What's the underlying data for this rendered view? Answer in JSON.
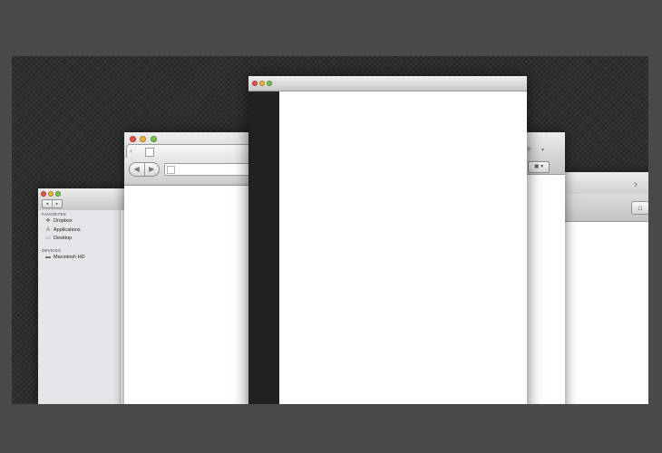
{
  "finder": {
    "nav_back": "◂",
    "nav_forward": "▸",
    "sections": [
      {
        "heading": "FAVORITES",
        "items": [
          {
            "label": "Dropbox",
            "icon": "dropbox-icon"
          },
          {
            "label": "Applications",
            "icon": "applications-icon"
          },
          {
            "label": "Desktop",
            "icon": "desktop-icon"
          }
        ]
      },
      {
        "heading": "DEVICES",
        "items": [
          {
            "label": "Macintosh HD",
            "icon": "hard-drive-icon"
          }
        ]
      }
    ]
  },
  "browser_left": {
    "back": "◀",
    "forward": "▶",
    "tab_nav": "‹"
  },
  "browser_right": {
    "forward_tab": "›",
    "home": "⌂"
  },
  "browser_back": {
    "new_tab": "+",
    "tab_menu": "▾",
    "toolbar_button": "▣ ▾"
  },
  "colors": {
    "close": "#e6534b",
    "minimize": "#e9b53a",
    "zoom": "#79c24a",
    "desktop": "#2f2f30",
    "main_sidebar": "#212121"
  }
}
